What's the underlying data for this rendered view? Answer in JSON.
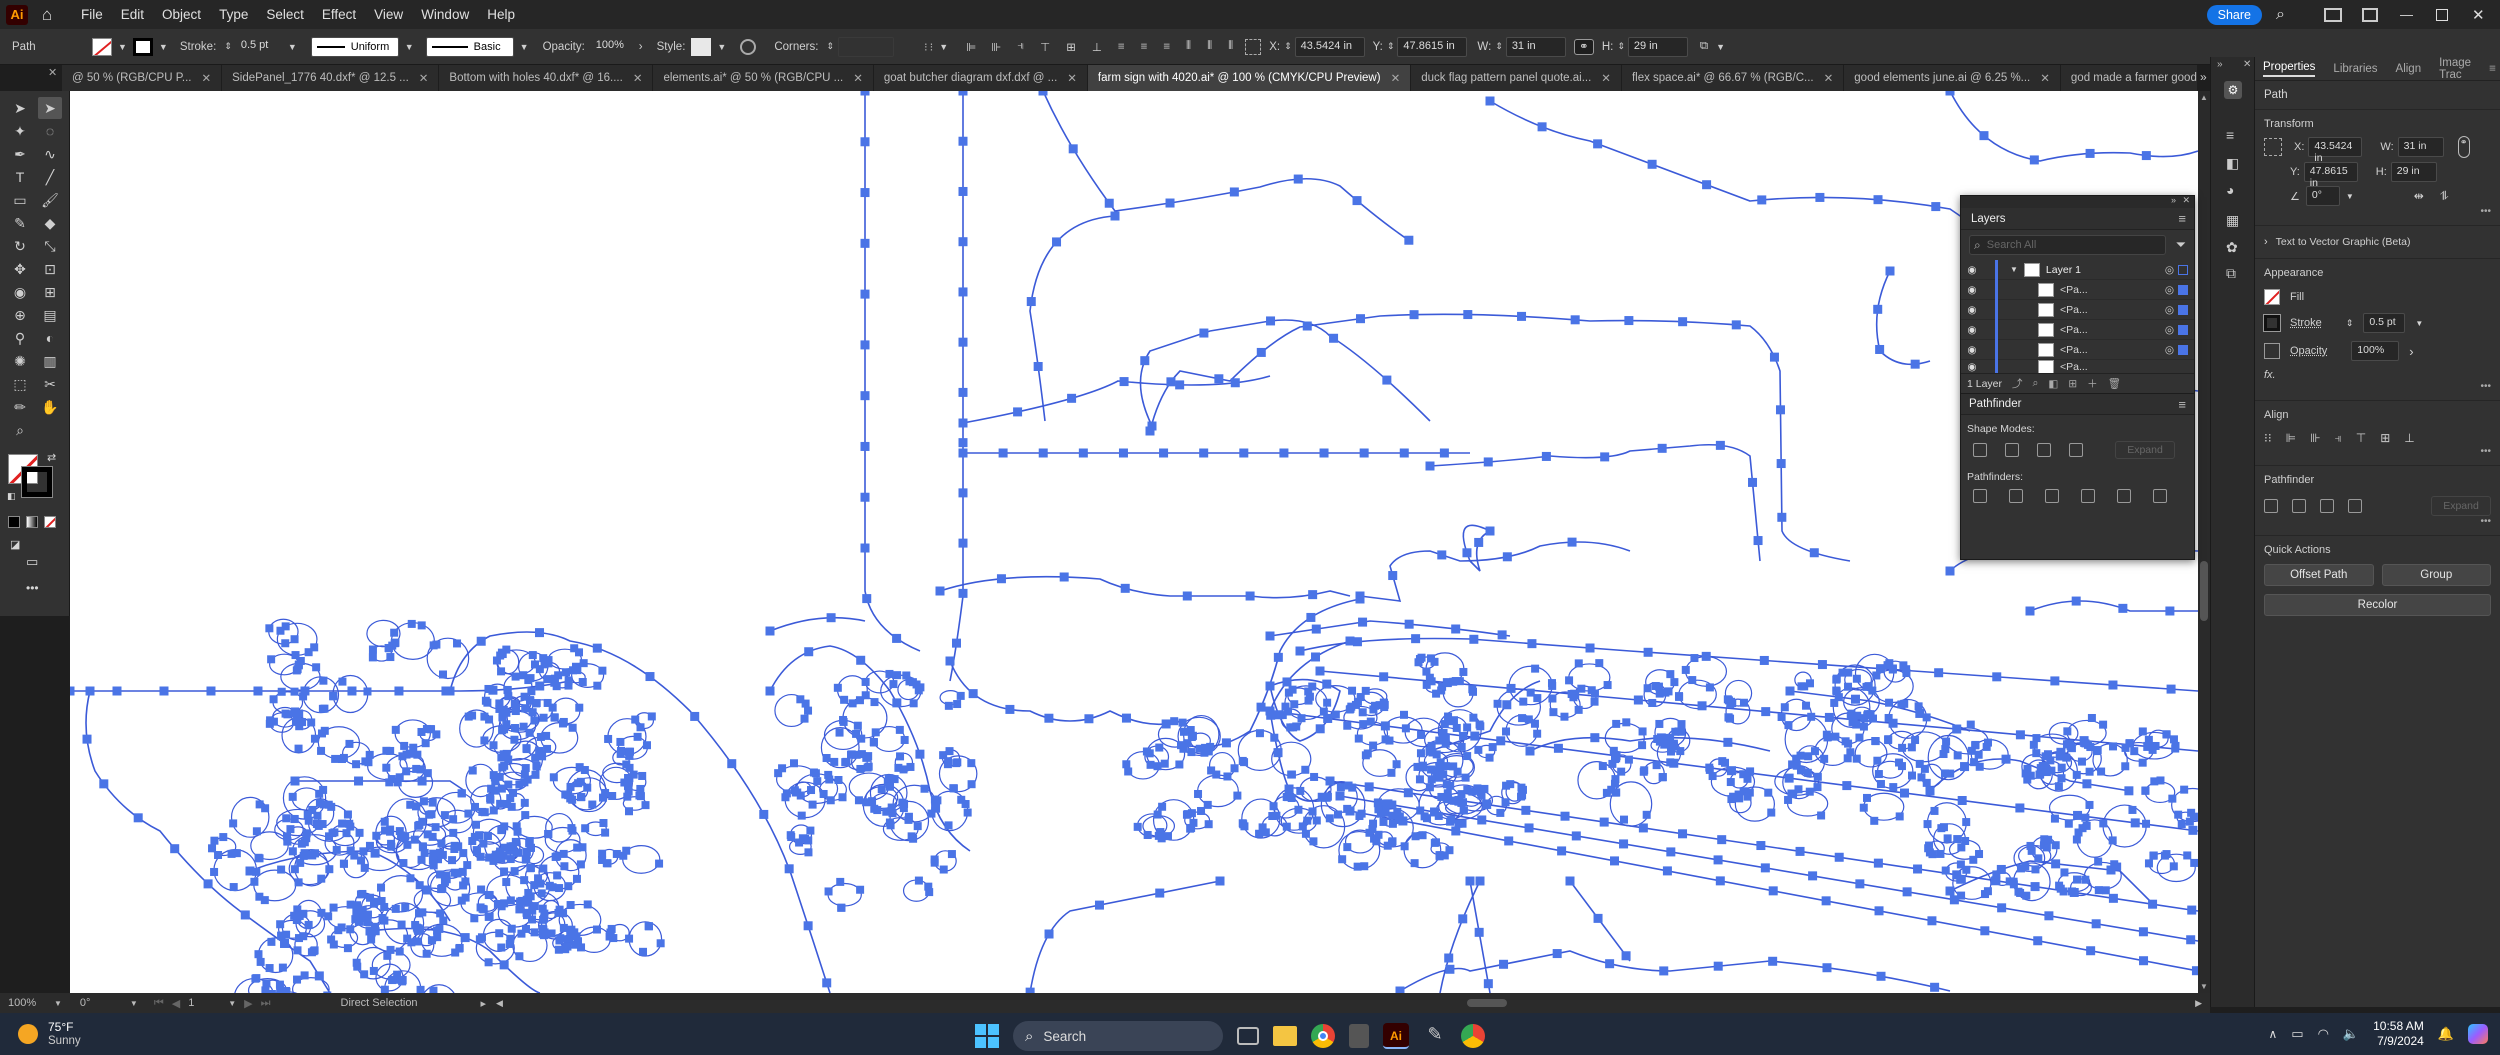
{
  "app": {
    "logo": "Ai",
    "share_label": "Share"
  },
  "menu": [
    "File",
    "Edit",
    "Object",
    "Type",
    "Select",
    "Effect",
    "View",
    "Window",
    "Help"
  ],
  "control": {
    "selection_label": "Path",
    "stroke_label": "Stroke:",
    "stroke_value": "0.5 pt",
    "profile_value": "Uniform",
    "brush_value": "Basic",
    "opacity_label": "Opacity:",
    "opacity_value": "100%",
    "style_label": "Style:",
    "corners_label": "Corners:",
    "x_label": "X:",
    "x_value": "43.5424 in",
    "y_label": "Y:",
    "y_value": "47.8615 in",
    "w_label": "W:",
    "w_value": "31 in",
    "h_label": "H:",
    "h_value": "29 in"
  },
  "tabs": [
    {
      "label": "@ 50 % (RGB/CPU P...",
      "active": false
    },
    {
      "label": "SidePanel_1776 40.dxf* @ 12.5 ...",
      "active": false
    },
    {
      "label": "Bottom with holes 40.dxf* @ 16....",
      "active": false
    },
    {
      "label": "elements.ai* @ 50 % (RGB/CPU ...",
      "active": false
    },
    {
      "label": "goat butcher diagram dxf.dxf @ ...",
      "active": false
    },
    {
      "label": "farm sign with 4020.ai* @ 100 % (CMYK/CPU Preview)",
      "active": true
    },
    {
      "label": "duck flag pattern panel quote.ai...",
      "active": false
    },
    {
      "label": "flex space.ai* @ 66.67 % (RGB/C...",
      "active": false
    },
    {
      "label": "good elements june.ai @ 6.25 %...",
      "active": false
    },
    {
      "label": "god made a farmer good elements w ez",
      "active": false
    }
  ],
  "layers_panel": {
    "title": "Layers",
    "search_placeholder": "Search All",
    "rows": [
      "Layer 1",
      "<Pa...",
      "<Pa...",
      "<Pa...",
      "<Pa...",
      "<Pa..."
    ],
    "footer_count": "1 Layer"
  },
  "pathfinder_panel": {
    "title": "Pathfinder",
    "shape_modes_label": "Shape Modes:",
    "expand_label": "Expand",
    "pathfinders_label": "Pathfinders:"
  },
  "properties": {
    "tabs": [
      "Properties",
      "Libraries",
      "Align",
      "Image Trac"
    ],
    "selection": "Path",
    "transform_title": "Transform",
    "x_label": "X:",
    "x_value": "43.5424 in",
    "y_label": "Y:",
    "y_value": "47.8615 in",
    "w_label": "W:",
    "w_value": "31 in",
    "h_label": "H:",
    "h_value": "29 in",
    "angle_value": "0°",
    "text_to_vector": "Text to Vector Graphic (Beta)",
    "appearance_title": "Appearance",
    "fill_label": "Fill",
    "stroke_label": "Stroke",
    "stroke_value": "0.5 pt",
    "opacity_label": "Opacity",
    "opacity_value": "100%",
    "fx_label": "fx.",
    "align_title": "Align",
    "pathfinder_title": "Pathfinder",
    "expand_label": "Expand",
    "quick_actions_title": "Quick Actions",
    "offset_path": "Offset Path",
    "group": "Group",
    "recolor": "Recolor"
  },
  "status": {
    "zoom": "100%",
    "angle": "0°",
    "artboard": "1",
    "tool": "Direct Selection"
  },
  "taskbar": {
    "temperature": "75°F",
    "weather": "Sunny",
    "search": "Search",
    "time": "10:58 AM",
    "date": "7/9/2024"
  },
  "colors": {
    "accent": "#1473e6",
    "anchor": "#4a74e6",
    "path": "#3b5ad8"
  }
}
